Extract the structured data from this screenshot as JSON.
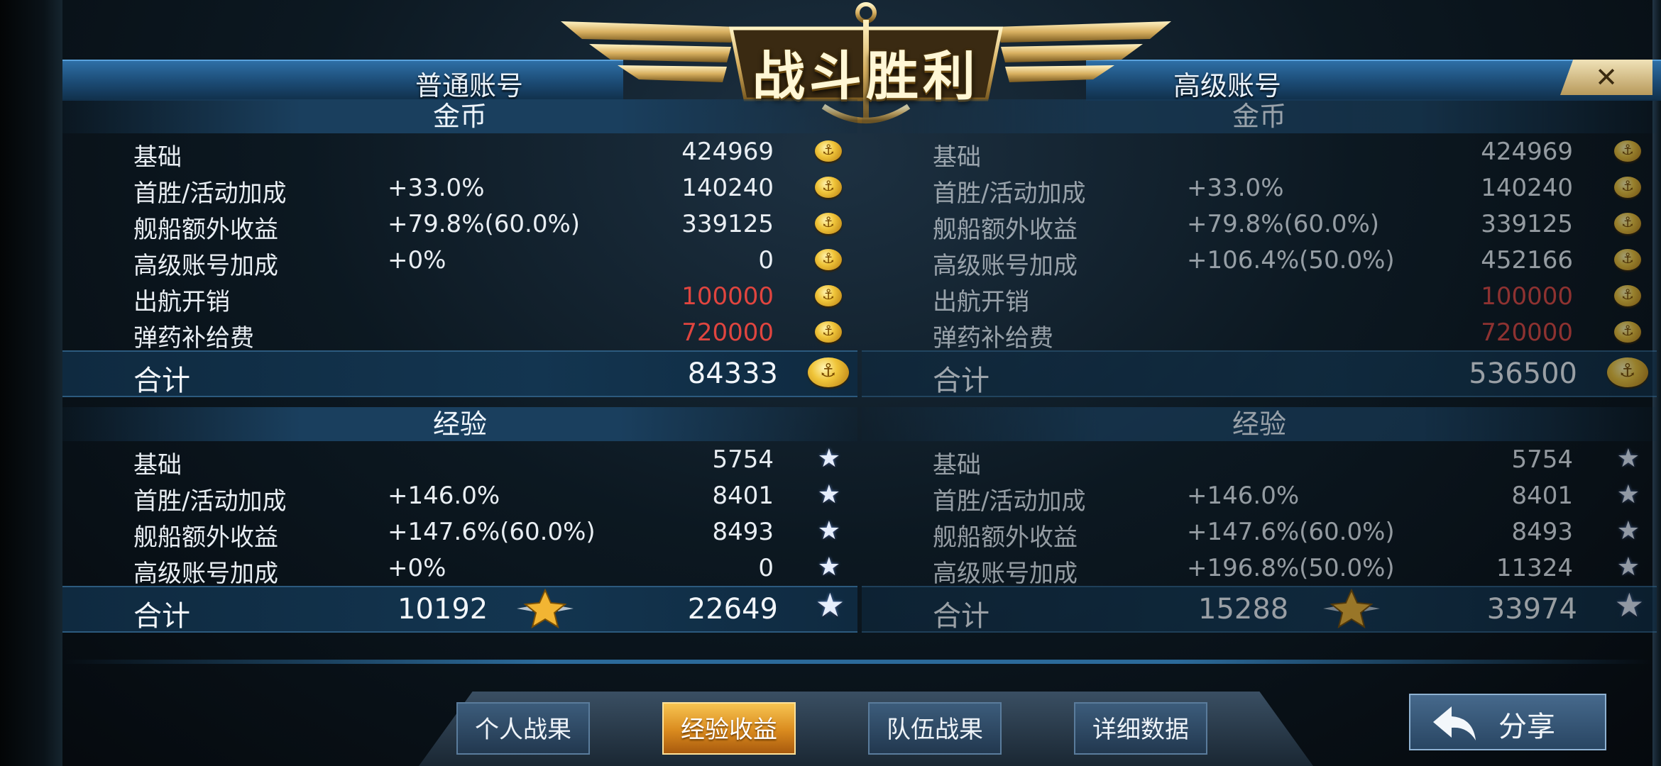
{
  "title": "战斗胜利",
  "close_symbol": "✕",
  "left_panel": {
    "header": "普通账号",
    "gold": {
      "section_title": "金币",
      "rows": [
        {
          "label": "基础",
          "pct": "",
          "value": "424969",
          "negative": false
        },
        {
          "label": "首胜/活动加成",
          "pct": "+33.0%",
          "value": "140240",
          "negative": false
        },
        {
          "label": "舰船额外收益",
          "pct": "+79.8%(60.0%)",
          "value": "339125",
          "negative": false
        },
        {
          "label": "高级账号加成",
          "pct": "+0%",
          "value": "0",
          "negative": false
        },
        {
          "label": "出航开销",
          "pct": "",
          "value": "100000",
          "negative": true
        },
        {
          "label": "弹药补给费",
          "pct": "",
          "value": "720000",
          "negative": true
        }
      ],
      "total_label": "合计",
      "total_value": "84333"
    },
    "exp": {
      "section_title": "经验",
      "rows": [
        {
          "label": "基础",
          "pct": "",
          "value": "5754"
        },
        {
          "label": "首胜/活动加成",
          "pct": "+146.0%",
          "value": "8401"
        },
        {
          "label": "舰船额外收益",
          "pct": "+147.6%(60.0%)",
          "value": "8493"
        },
        {
          "label": "高级账号加成",
          "pct": "+0%",
          "value": "0"
        }
      ],
      "total_label": "合计",
      "total_commander": "10192",
      "total_value": "22649"
    }
  },
  "right_panel": {
    "header": "高级账号",
    "gold": {
      "section_title": "金币",
      "rows": [
        {
          "label": "基础",
          "pct": "",
          "value": "424969",
          "negative": false
        },
        {
          "label": "首胜/活动加成",
          "pct": "+33.0%",
          "value": "140240",
          "negative": false
        },
        {
          "label": "舰船额外收益",
          "pct": "+79.8%(60.0%)",
          "value": "339125",
          "negative": false
        },
        {
          "label": "高级账号加成",
          "pct": "+106.4%(50.0%)",
          "value": "452166",
          "negative": false
        },
        {
          "label": "出航开销",
          "pct": "",
          "value": "100000",
          "negative": true
        },
        {
          "label": "弹药补给费",
          "pct": "",
          "value": "720000",
          "negative": true
        }
      ],
      "total_label": "合计",
      "total_value": "536500"
    },
    "exp": {
      "section_title": "经验",
      "rows": [
        {
          "label": "基础",
          "pct": "",
          "value": "5754"
        },
        {
          "label": "首胜/活动加成",
          "pct": "+146.0%",
          "value": "8401"
        },
        {
          "label": "舰船额外收益",
          "pct": "+147.6%(60.0%)",
          "value": "8493"
        },
        {
          "label": "高级账号加成",
          "pct": "+196.8%(50.0%)",
          "value": "11324"
        }
      ],
      "total_label": "合计",
      "total_commander": "15288",
      "total_value": "33974"
    }
  },
  "tabs": [
    {
      "label": "个人战果",
      "active": false
    },
    {
      "label": "经验收益",
      "active": true
    },
    {
      "label": "队伍战果",
      "active": false
    },
    {
      "label": "详细数据",
      "active": false
    }
  ],
  "share_label": "分享",
  "colors": {
    "negative": "#e0453f",
    "active_tab": "#e8a030",
    "banner": "#1b4a73"
  },
  "icons": [
    "gold-coin-icon",
    "exp-star-icon",
    "commander-star-icon",
    "anchor-emblem-icon",
    "share-arrow-icon",
    "close-icon"
  ]
}
